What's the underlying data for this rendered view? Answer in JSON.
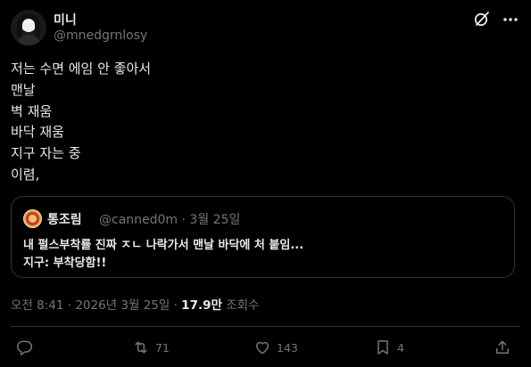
{
  "author": {
    "name": "미니",
    "handle": "@mnedgrnlosy"
  },
  "tweet": {
    "lines": [
      "저는 수면 에임 안 좋아서",
      "맨날",
      "벽 재움",
      "바닥 재움",
      "지구 자는 중",
      "이렴,"
    ]
  },
  "quote": {
    "author_name": "통조림",
    "handle_date": "@canned0m · 3월 25일",
    "line1": "내 펄스부착률 진짜 ㅈㄴ 나락가서 맨날 바닥에 처 붙임...",
    "line2": "지구: 부착당함!!"
  },
  "meta": {
    "timestamp": "오전 8:41 · 2026년 3월 25일 · ",
    "views_count": "17.9만",
    "views_label": " 조회수"
  },
  "actions": {
    "reply_count": "",
    "retweet_count": "71",
    "like_count": "143",
    "bookmark_count": "4"
  },
  "icons": {
    "grok": "grok-icon",
    "more": "more-icon",
    "reply": "reply-icon",
    "retweet": "retweet-icon",
    "like": "heart-icon",
    "bookmark": "bookmark-icon",
    "share": "share-icon"
  },
  "colors": {
    "background": "#000000",
    "text": "#e7e9ea",
    "secondary": "#71767b",
    "border": "#2f3336"
  }
}
